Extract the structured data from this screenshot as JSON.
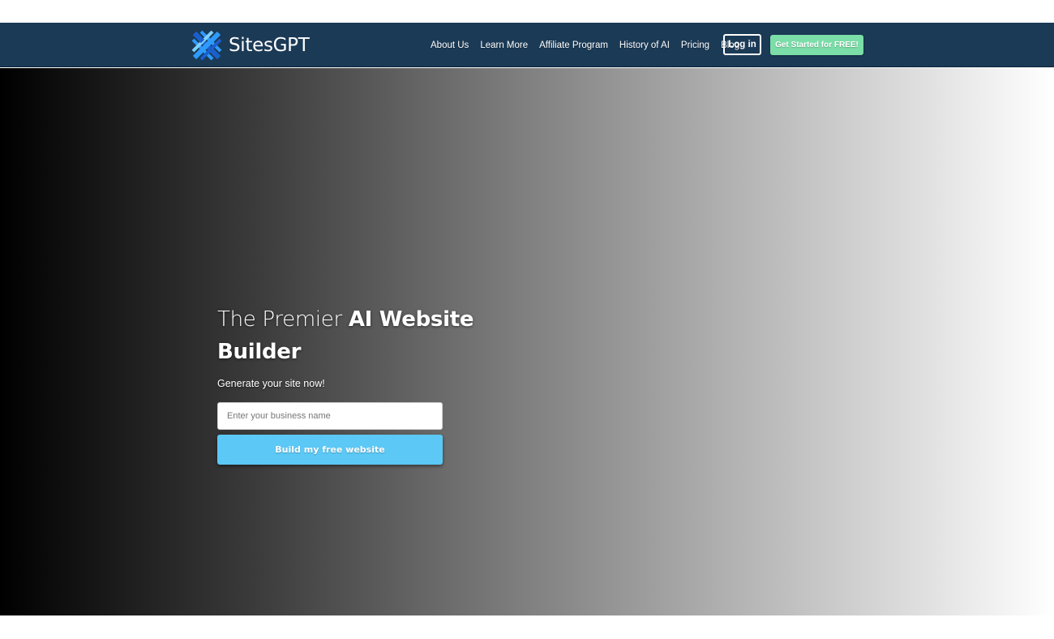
{
  "brand": {
    "name": "SitesGPT",
    "logo_icon": "woven-x-logo-icon",
    "logo_colors": [
      "#2e9bff",
      "#1a5fcc",
      "#7fd0ff"
    ]
  },
  "nav": {
    "items": [
      {
        "label": "About Us"
      },
      {
        "label": "Learn More"
      },
      {
        "label": "Affiliate Program"
      },
      {
        "label": "History of AI"
      },
      {
        "label": "Pricing"
      },
      {
        "label": "Blog"
      }
    ],
    "login_label": "Log in",
    "cta_label": "Get Started for FREE!"
  },
  "hero": {
    "title_light": "The Premier ",
    "title_bold": "AI Website Builder",
    "subtitle": "Generate your site now!",
    "input_placeholder": "Enter your business name",
    "input_value": "",
    "button_label": "Build my free website"
  },
  "colors": {
    "navbar_bg": "#1b3a56",
    "cta_bg": "#7bdda8",
    "build_button_bg": "#5bc8f5"
  }
}
